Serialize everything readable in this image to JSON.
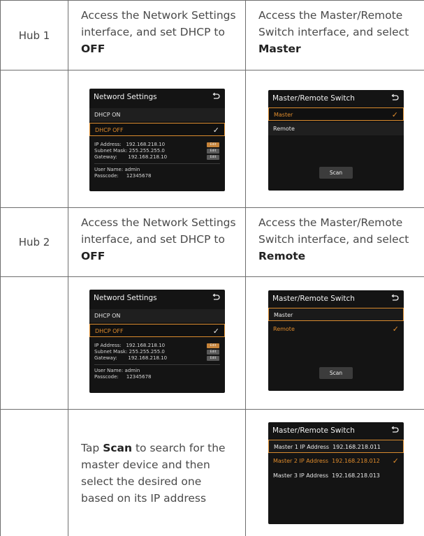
{
  "rows": [
    {
      "hub": "Hub 1",
      "left_instruction_pre": "Access the Network Settings interface, and set DHCP to",
      "left_instruction_bold": "OFF",
      "right_instruction_pre": "Access the Master/Remote Switch interface, and select",
      "right_instruction_bold": "Master"
    },
    {
      "hub": "Hub 2",
      "left_instruction_pre": "Access the Network Settings interface, and set DHCP to",
      "left_instruction_bold": "OFF",
      "right_instruction_pre": "Access the Master/Remote Switch interface, and select",
      "right_instruction_bold": "Remote"
    }
  ],
  "network_screen": {
    "title": "Netword Settings",
    "dhcp_on": "DHCP ON",
    "dhcp_off": "DHCP OFF",
    "ip_label": "IP Address:",
    "ip_value": "192.168.218.10",
    "mask_label": "Subnet Mask:",
    "mask_value": "255.255.255.0",
    "gateway_label": "Gateway:",
    "gateway_value": "192.168.218.10",
    "edit_label": "Edit",
    "user_label": "User Name:",
    "user_value": "admin",
    "pass_label": "Passcode:",
    "pass_value": "12345678"
  },
  "switch_screen": {
    "title": "Master/Remote Switch",
    "master": "Master",
    "remote": "Remote",
    "scan": "Scan"
  },
  "scan_row": {
    "instruction_pre": "Tap",
    "instruction_bold": "Scan",
    "instruction_post": "to search for the master device and then select the desired one based on its IP address",
    "screen_title": "Master/Remote Switch",
    "items": [
      "Master 1 IP Address  192.168.218.011",
      "Master 2 IP Address  192.168.218.012",
      "Master 3 IP Address  192.168.218.013"
    ]
  },
  "colors": {
    "accent": "#d98b2e",
    "screen_bg": "#141414",
    "border": "#6e6e6e"
  }
}
